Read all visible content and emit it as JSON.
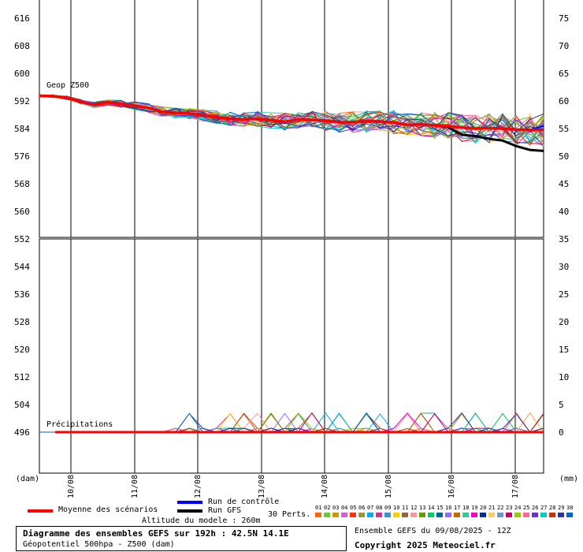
{
  "chart_data": {
    "type": "line",
    "top_panel": {
      "label": "Geop Z500",
      "left_ticks": [
        "616",
        "608",
        "600",
        "592",
        "584",
        "576",
        "568",
        "560",
        "552"
      ],
      "right_ticks": [
        "75",
        "70",
        "65",
        "60",
        "55",
        "50",
        "45",
        "40",
        "35"
      ],
      "ylim": [
        552,
        620
      ],
      "mean_series": [
        593.5,
        593.4,
        592.9,
        591.8,
        590.9,
        591.6,
        591.2,
        590.6,
        590.0,
        588.9,
        588.6,
        588.4,
        587.8,
        587.3,
        586.8,
        586.7,
        586.8,
        586.4,
        586.0,
        586.6,
        586.5,
        586.3,
        585.8,
        585.9,
        586.1,
        586.0,
        585.8,
        585.0,
        585.2,
        584.9,
        584.7,
        584.3,
        584.0,
        584.1,
        584.0,
        583.7,
        583.6,
        583.6
      ],
      "gfs_series": [
        593.5,
        593.4,
        592.9,
        591.8,
        590.9,
        591.6,
        591.2,
        590.6,
        590.0,
        588.9,
        588.6,
        588.4,
        587.8,
        587.3,
        586.8,
        586.7,
        586.8,
        586.4,
        586.0,
        586.6,
        586.5,
        586.3,
        585.8,
        585.9,
        586.1,
        586.0,
        585.8,
        585.0,
        585.2,
        584.9,
        584.4,
        582.2,
        581.8,
        581.0,
        580.5,
        578.9,
        577.8,
        577.5
      ],
      "control_series": [
        593.5,
        593.4,
        592.9,
        591.8,
        590.9,
        591.6,
        591.2,
        590.6,
        590.0,
        588.9,
        588.6,
        588.4,
        587.8,
        587.3,
        586.8,
        586.7,
        586.8,
        586.4,
        586.0,
        586.6,
        586.5,
        586.3,
        585.8,
        585.9,
        586.1,
        586.0,
        585.8,
        585.0,
        585.2,
        584.9,
        584.7,
        584.3,
        584.0,
        584.1,
        584.0,
        583.7,
        583.6,
        584.8
      ]
    },
    "bottom_panel": {
      "label": "Précipitations",
      "left_ticks": [
        "544",
        "536",
        "528",
        "520",
        "512",
        "504",
        "496"
      ],
      "right_ticks": [
        "30",
        "25",
        "20",
        "15",
        "10",
        "5",
        "0"
      ],
      "ylim": [
        0,
        35
      ]
    },
    "x_ticks": [
      "10/08",
      "11/08",
      "12/08",
      "13/08",
      "14/08",
      "15/08",
      "16/08",
      "17/08"
    ],
    "left_unit": "(dam)",
    "right_unit": "(mm)"
  },
  "legend": {
    "mean": "Moyenne des scénarios",
    "control": "Run de contrôle",
    "gfs": "Run GFS",
    "altitude": "Altitude du modele : 260m",
    "perts_label": "30 Perts.",
    "pert_numbers": [
      "01",
      "02",
      "03",
      "04",
      "05",
      "06",
      "07",
      "08",
      "09",
      "10",
      "11",
      "12",
      "13",
      "14",
      "15",
      "16",
      "17",
      "18",
      "19",
      "20",
      "21",
      "22",
      "23",
      "24",
      "25",
      "26",
      "27",
      "28",
      "29",
      "30"
    ],
    "pert_colors": [
      "#ff6600",
      "#66cc33",
      "#cc9900",
      "#cc66cc",
      "#ff3300",
      "#999933",
      "#00aaff",
      "#cc3399",
      "#3399cc",
      "#ffcc00",
      "#996633",
      "#ff9999",
      "#669900",
      "#00cc66",
      "#006699",
      "#9966ff",
      "#cc6600",
      "#33cc99",
      "#ff00cc",
      "#003399",
      "#ffcc66",
      "#6699cc",
      "#cc0066",
      "#99cc00",
      "#ff6699",
      "#6633cc",
      "#00cccc",
      "#cc3300",
      "#333399",
      "#0066cc"
    ]
  },
  "footer": {
    "title": "Diagramme des ensembles GEFS sur 192h : 42.5N 14.1E",
    "subtitle": "Géopotentiel 500hpa - Z500 (dam)",
    "ensemble": "Ensemble GEFS du 09/08/2025 - 12Z",
    "copyright": "Copyright 2025 Meteociel.fr"
  },
  "colors": {
    "mean": "#ff0000",
    "control": "#0000ff",
    "gfs": "#000000"
  }
}
